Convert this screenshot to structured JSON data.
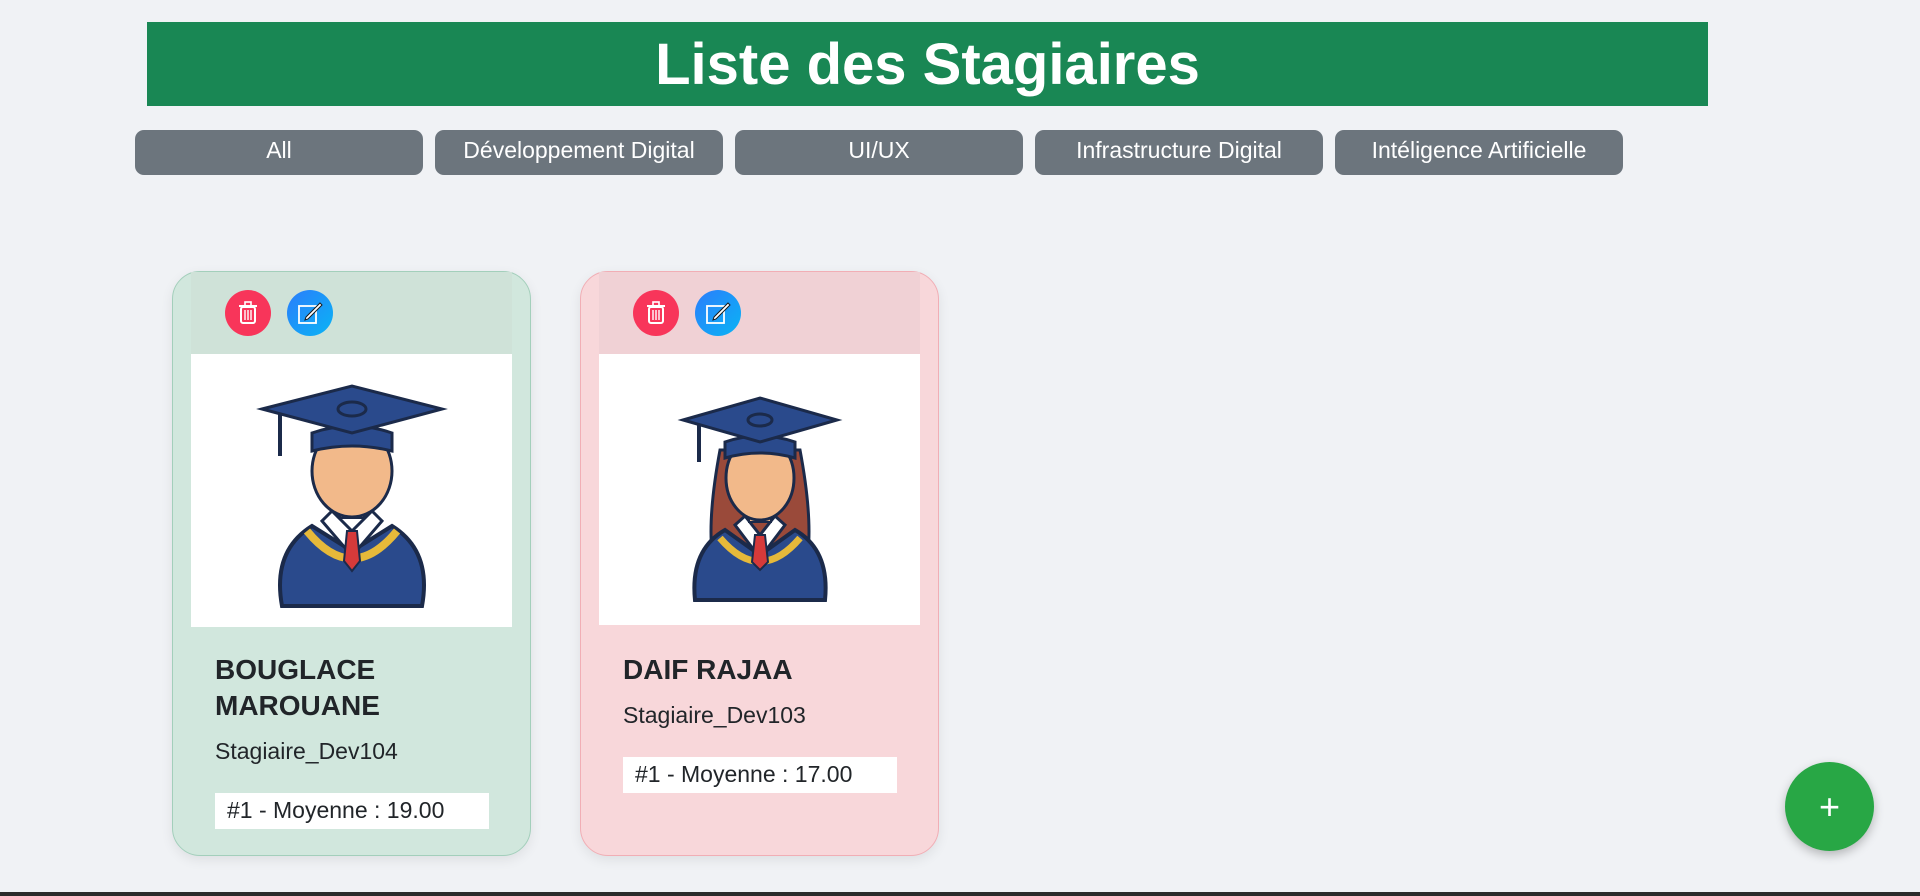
{
  "header": {
    "title": "Liste des Stagiaires"
  },
  "filters": [
    {
      "label": "All"
    },
    {
      "label": "Développement Digital"
    },
    {
      "label": "UI/UX"
    },
    {
      "label": "Infrastructure Digital"
    },
    {
      "label": "Intéligence Artificielle"
    }
  ],
  "cards": [
    {
      "name": "BOUGLACE MAROUANE",
      "role": "Stagiaire_Dev104",
      "average": "#1 - Moyenne : 19.00",
      "status_color": "#d1e7dd"
    },
    {
      "name": "DAIF RAJAA",
      "role": "Stagiaire_Dev103",
      "average": "#1 - Moyenne : 17.00",
      "status_color": "#f8d7da"
    }
  ],
  "fab": {
    "label": "+"
  },
  "icons": {
    "delete": "trash-icon",
    "edit": "edit-icon",
    "avatar_male": "graduate-male-icon",
    "avatar_female": "graduate-female-icon"
  },
  "colors": {
    "header": "#198754",
    "filter": "#6c757d",
    "delete": "#f8355a",
    "edit": "#0d8bf5",
    "fab": "#28a745"
  }
}
